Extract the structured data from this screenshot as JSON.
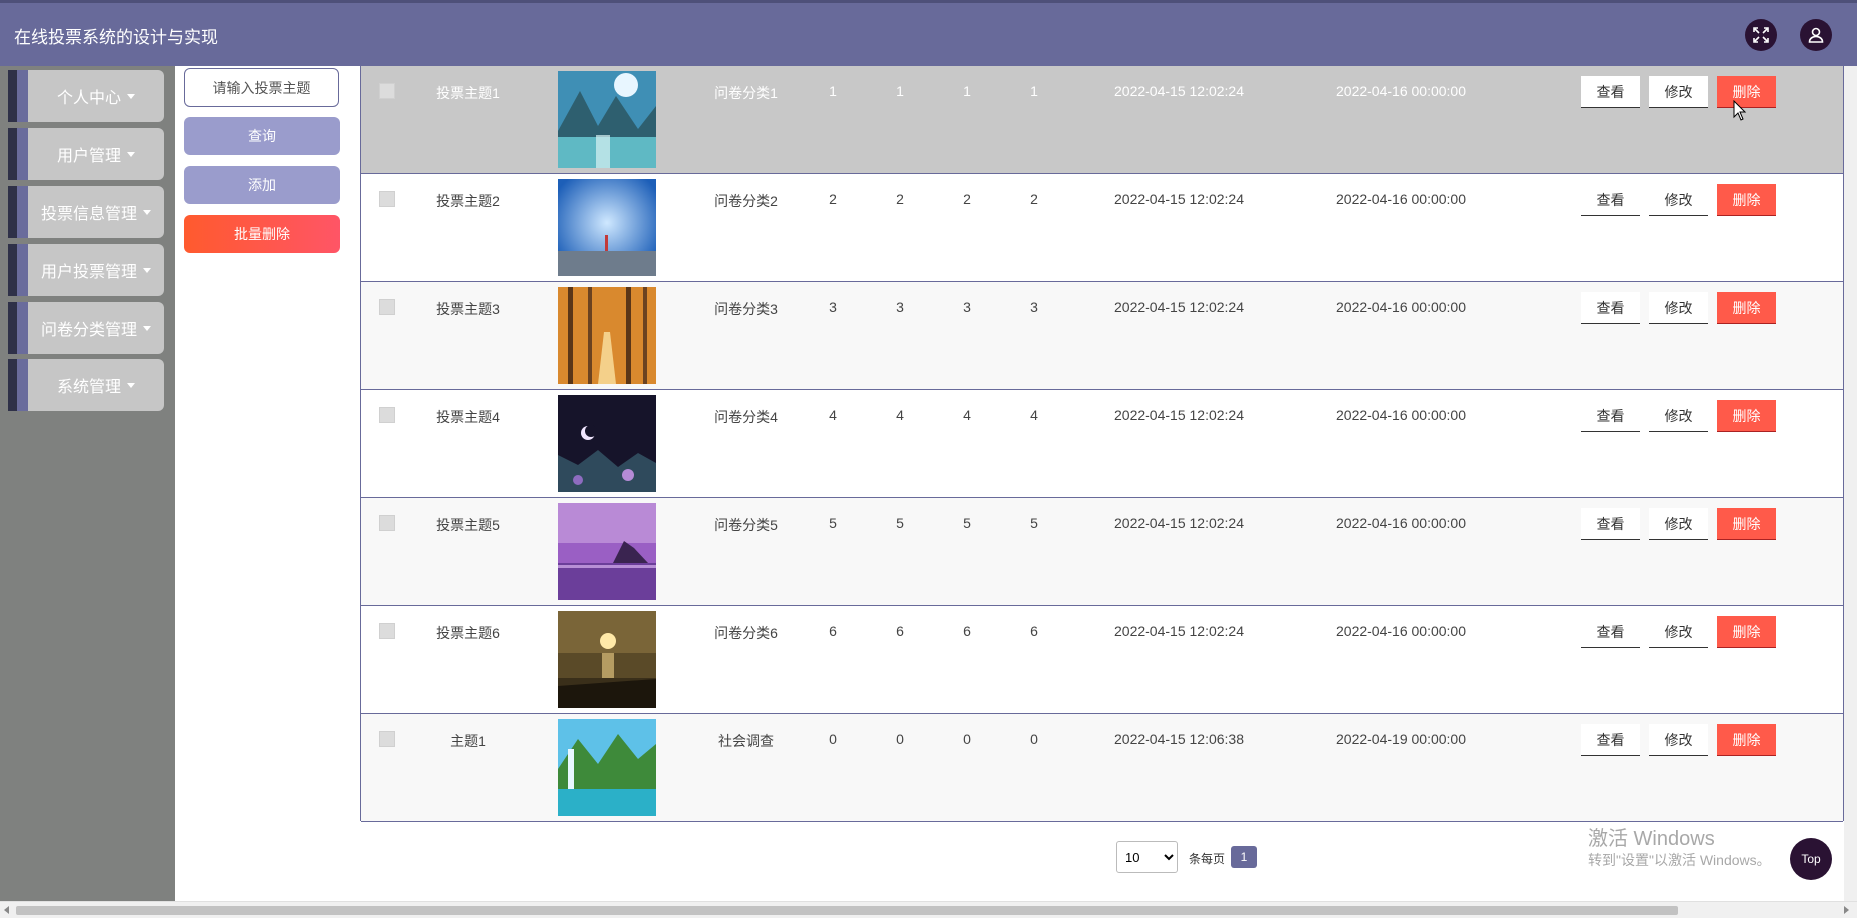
{
  "header": {
    "title": "在线投票系统的设计与实现",
    "fullscreen_icon": "expand-arrows-icon",
    "user_icon": "user-icon",
    "color": "#686a9a"
  },
  "sidebar": {
    "items": [
      {
        "label": "个人中心"
      },
      {
        "label": "用户管理"
      },
      {
        "label": "投票信息管理"
      },
      {
        "label": "用户投票管理"
      },
      {
        "label": "问卷分类管理"
      },
      {
        "label": "系统管理"
      }
    ]
  },
  "filter": {
    "search_placeholder": "请输入投票主题",
    "query_label": "查询",
    "add_label": "添加",
    "batch_delete_label": "批量删除"
  },
  "table": {
    "rows": [
      {
        "title": "投票主题1",
        "category": "问卷分类1",
        "c1": "1",
        "c2": "1",
        "c3": "1",
        "c4": "1",
        "start": "2022-04-15 12:02:24",
        "end": "2022-04-16 00:00:00",
        "image": "mountain-lake"
      },
      {
        "title": "投票主题2",
        "category": "问卷分类2",
        "c1": "2",
        "c2": "2",
        "c3": "2",
        "c4": "2",
        "start": "2022-04-15 12:02:24",
        "end": "2022-04-16 00:00:00",
        "image": "blue-sky-figure"
      },
      {
        "title": "投票主题3",
        "category": "问卷分类3",
        "c1": "3",
        "c2": "3",
        "c3": "3",
        "c4": "3",
        "start": "2022-04-15 12:02:24",
        "end": "2022-04-16 00:00:00",
        "image": "autumn-forest"
      },
      {
        "title": "投票主题4",
        "category": "问卷分类4",
        "c1": "4",
        "c2": "4",
        "c3": "4",
        "c4": "4",
        "start": "2022-04-15 12:02:24",
        "end": "2022-04-16 00:00:00",
        "image": "night-moon"
      },
      {
        "title": "投票主题5",
        "category": "问卷分类5",
        "c1": "5",
        "c2": "5",
        "c3": "5",
        "c4": "5",
        "start": "2022-04-15 12:02:24",
        "end": "2022-04-16 00:00:00",
        "image": "purple-sea"
      },
      {
        "title": "投票主题6",
        "category": "问卷分类6",
        "c1": "6",
        "c2": "6",
        "c3": "6",
        "c4": "6",
        "start": "2022-04-15 12:02:24",
        "end": "2022-04-16 00:00:00",
        "image": "sunset-beach"
      },
      {
        "title": "主题1",
        "category": "社会调查",
        "c1": "0",
        "c2": "0",
        "c3": "0",
        "c4": "0",
        "start": "2022-04-15 12:06:38",
        "end": "2022-04-19 00:00:00",
        "image": "waterfall"
      }
    ],
    "view_label": "查看",
    "edit_label": "修改",
    "delete_label": "删除"
  },
  "pagination": {
    "page_size": "10",
    "page_size_label": "条每页",
    "current_page": "1"
  },
  "watermark": {
    "title": "激活 Windows",
    "subtitle": "转到\"设置\"以激活 Windows。"
  },
  "top_button_label": "Top"
}
